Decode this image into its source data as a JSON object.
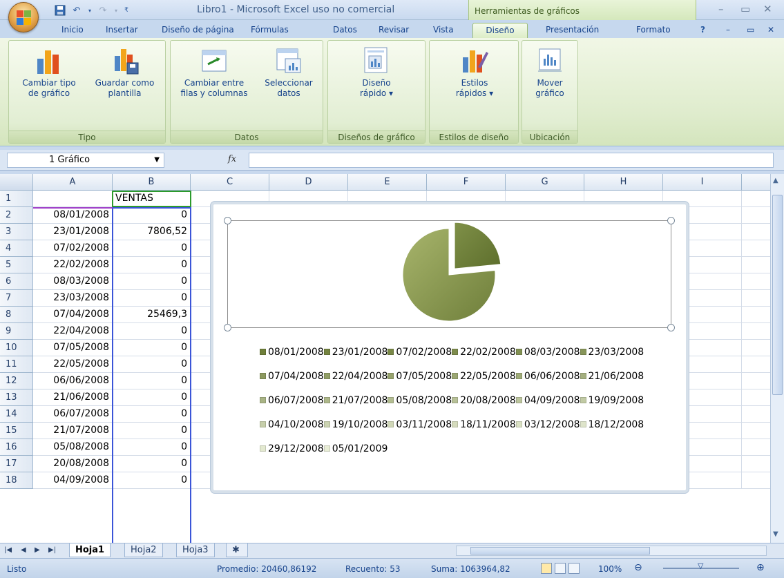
{
  "window": {
    "title": "Libro1 - Microsoft Excel uso no comercial",
    "context_tab_group": "Herramientas de gráficos"
  },
  "tabs": [
    "Inicio",
    "Insertar",
    "Diseño de página",
    "Fórmulas",
    "Datos",
    "Revisar",
    "Vista",
    "Diseño",
    "Presentación",
    "Formato"
  ],
  "active_tab": "Diseño",
  "ribbon": {
    "groups": [
      {
        "label": "Tipo",
        "buttons": [
          {
            "l1": "Cambiar tipo",
            "l2": "de gráfico"
          },
          {
            "l1": "Guardar como",
            "l2": "plantilla"
          }
        ]
      },
      {
        "label": "Datos",
        "buttons": [
          {
            "l1": "Cambiar entre",
            "l2": "filas y columnas"
          },
          {
            "l1": "Seleccionar",
            "l2": "datos"
          }
        ]
      },
      {
        "label": "Diseños de gráfico",
        "buttons": [
          {
            "l1": "Diseño",
            "l2": "rápido ▾"
          }
        ]
      },
      {
        "label": "Estilos de diseño",
        "buttons": [
          {
            "l1": "Estilos",
            "l2": "rápidos ▾"
          }
        ]
      },
      {
        "label": "Ubicación",
        "buttons": [
          {
            "l1": "Mover",
            "l2": "gráfico"
          }
        ]
      }
    ]
  },
  "formula_bar": {
    "name_box": "1 Gráfico",
    "fx_label": "fx",
    "formula": ""
  },
  "grid": {
    "columns": [
      "A",
      "B",
      "C",
      "D",
      "E",
      "F",
      "G",
      "H",
      "I"
    ],
    "rows": [
      {
        "n": "1",
        "a": "",
        "b": "VENTAS"
      },
      {
        "n": "2",
        "a": "08/01/2008",
        "b": "0"
      },
      {
        "n": "3",
        "a": "23/01/2008",
        "b": "7806,52"
      },
      {
        "n": "4",
        "a": "07/02/2008",
        "b": "0"
      },
      {
        "n": "5",
        "a": "22/02/2008",
        "b": "0"
      },
      {
        "n": "6",
        "a": "08/03/2008",
        "b": "0"
      },
      {
        "n": "7",
        "a": "23/03/2008",
        "b": "0"
      },
      {
        "n": "8",
        "a": "07/04/2008",
        "b": "25469,3"
      },
      {
        "n": "9",
        "a": "22/04/2008",
        "b": "0"
      },
      {
        "n": "10",
        "a": "07/05/2008",
        "b": "0"
      },
      {
        "n": "11",
        "a": "22/05/2008",
        "b": "0"
      },
      {
        "n": "12",
        "a": "06/06/2008",
        "b": "0"
      },
      {
        "n": "13",
        "a": "21/06/2008",
        "b": "0"
      },
      {
        "n": "14",
        "a": "06/07/2008",
        "b": "0"
      },
      {
        "n": "15",
        "a": "21/07/2008",
        "b": "0"
      },
      {
        "n": "16",
        "a": "05/08/2008",
        "b": "0"
      },
      {
        "n": "17",
        "a": "20/08/2008",
        "b": "0"
      },
      {
        "n": "18",
        "a": "04/09/2008",
        "b": "0"
      }
    ]
  },
  "chart_data": {
    "type": "pie",
    "categories": [
      "08/01/2008",
      "23/01/2008",
      "07/02/2008",
      "22/02/2008",
      "08/03/2008",
      "23/03/2008",
      "07/04/2008",
      "22/04/2008",
      "07/05/2008",
      "22/05/2008",
      "06/06/2008",
      "21/06/2008",
      "06/07/2008",
      "21/07/2008",
      "05/08/2008",
      "20/08/2008",
      "04/09/2008",
      "19/09/2008",
      "04/10/2008",
      "19/10/2008",
      "03/11/2008",
      "18/11/2008",
      "03/12/2008",
      "18/12/2008",
      "29/12/2008",
      "05/01/2009"
    ],
    "values": [
      0,
      7806.52,
      0,
      0,
      0,
      0,
      25469.3,
      0,
      0,
      0,
      0,
      0,
      0,
      0,
      0,
      0,
      0,
      0,
      0,
      0,
      0,
      0,
      0,
      0,
      0,
      0
    ],
    "legend_position": "bottom",
    "colors": {
      "main": "#8a9a4f",
      "exploded": "#6f7f3a"
    }
  },
  "sheets": [
    "Hoja1",
    "Hoja2",
    "Hoja3"
  ],
  "active_sheet": "Hoja1",
  "status": {
    "mode": "Listo",
    "average": "Promedio: 20460,86192",
    "count": "Recuento: 53",
    "sum": "Suma: 1063964,82",
    "zoom": "100%"
  }
}
